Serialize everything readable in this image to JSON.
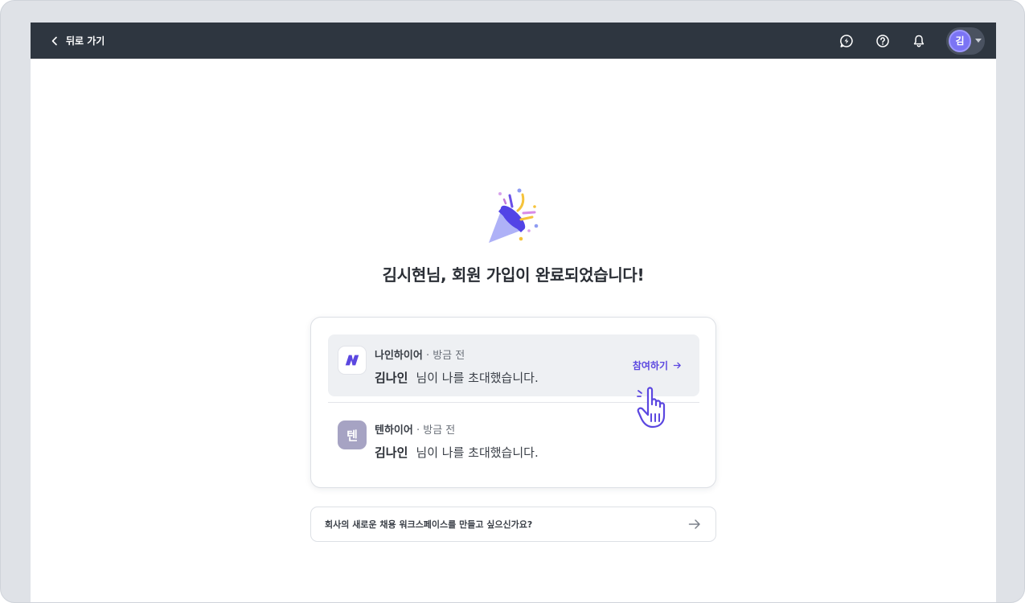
{
  "header": {
    "back_label": "뒤로 가기",
    "avatar_initial": "김",
    "icons": [
      "chat-icon",
      "help-icon",
      "bell-icon",
      "chevron-down-icon"
    ]
  },
  "main": {
    "headline": "김시현님, 회원 가입이 완료되었습니다!",
    "invites": [
      {
        "workspace": "나인하이어",
        "time": "· 방금 전",
        "inviter": "김나인",
        "message": "님이 나를 초대했습니다.",
        "join_label": "참여하기"
      },
      {
        "workspace": "텐하이어",
        "logo_initial": "텐",
        "time": "· 방금 전",
        "inviter": "김나인",
        "message": "님이 나를 초대했습니다."
      }
    ],
    "create_workspace_label": "회사의 새로운 채용 워크스페이스를 만들고 싶으신가요?"
  },
  "colors": {
    "topbar": "#2e3640",
    "accent": "#5b47e0",
    "avatar": "#7b74f4",
    "ten_logo": "#a6a3c3"
  }
}
